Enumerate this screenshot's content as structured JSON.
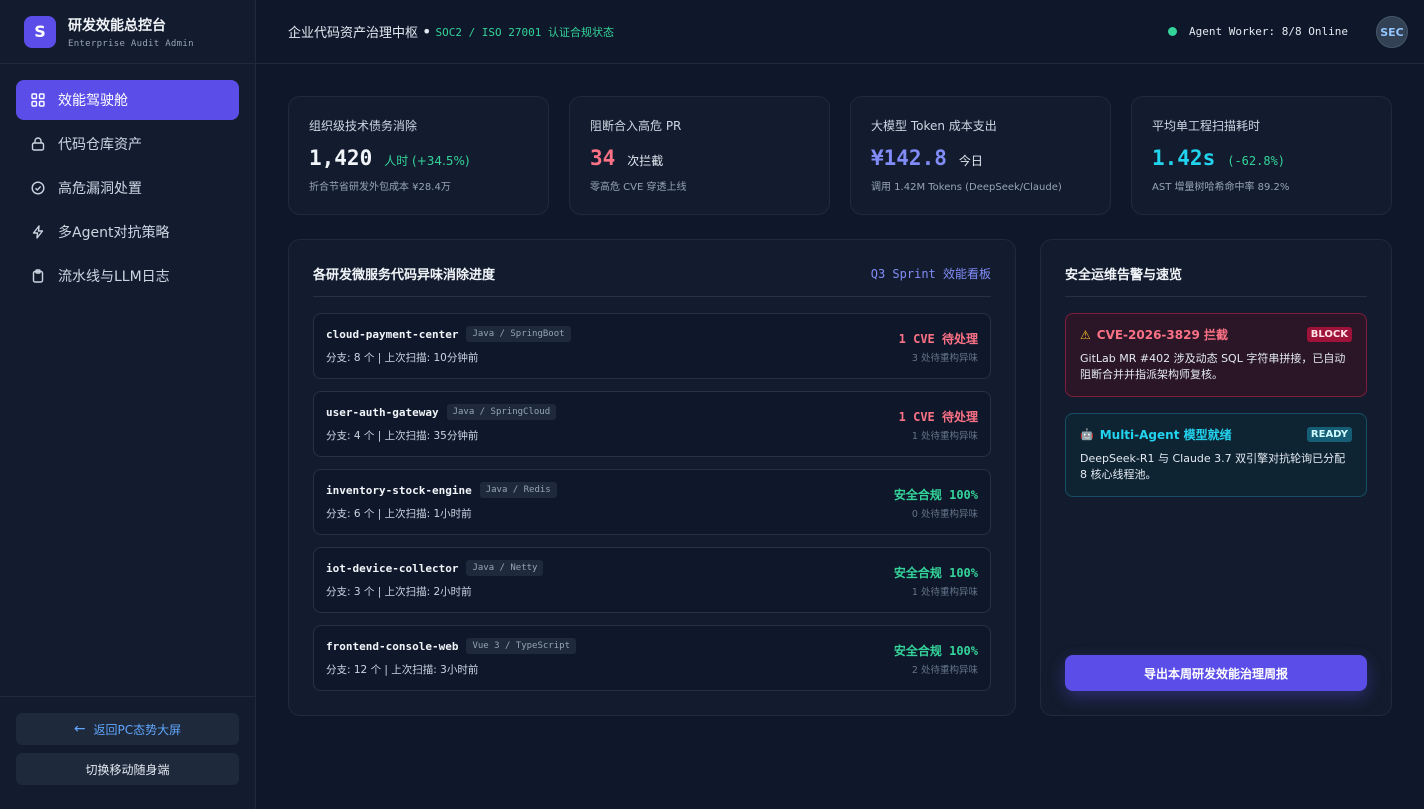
{
  "brand": {
    "logo": "S",
    "title": "研发效能总控台",
    "subtitle": "Enterprise Audit Admin"
  },
  "nav": [
    {
      "label": "效能驾驶舱",
      "icon": "grid-icon",
      "active": true
    },
    {
      "label": "代码仓库资产",
      "icon": "lock-icon",
      "active": false
    },
    {
      "label": "高危漏洞处置",
      "icon": "check-circle-icon",
      "active": false
    },
    {
      "label": "多Agent对抗策略",
      "icon": "bolt-icon",
      "active": false
    },
    {
      "label": "流水线与LLM日志",
      "icon": "clipboard-icon",
      "active": false
    }
  ],
  "sidebar_buttons": {
    "back_arrow": "←",
    "back": "返回PC态势大屏",
    "mobile": "切换移动随身端"
  },
  "header": {
    "title": "企业代码资产治理中枢",
    "dot": "•",
    "subtitle": "SOC2 / ISO 27001 认证合规状态",
    "agent_status": "Agent Worker: 8/8 Online",
    "avatar": "SEC"
  },
  "kpis": [
    {
      "label": "组织级技术债务消除",
      "value": "1,420",
      "unit": "人时 (+34.5%)",
      "note": "折合节省研发外包成本 ¥28.4万",
      "value_color": "#f1f5f9",
      "unit_color": "#34d399"
    },
    {
      "label": "阻断合入高危 PR",
      "value": "34",
      "unit": "次拦截",
      "note": "零高危 CVE 穿透上线",
      "value_color": "#fb7185",
      "unit_color": "#e2e8f0"
    },
    {
      "label": "大模型 Token 成本支出",
      "value": "¥142.8",
      "unit": "今日",
      "note": "调用 1.42M Tokens (DeepSeek/Claude)",
      "value_color": "#818cf8",
      "unit_color": "#e2e8f0"
    },
    {
      "label": "平均单工程扫描耗时",
      "value": "1.42s",
      "unit": "(-62.8%)",
      "note": "AST 增量树哈希命中率 89.2%",
      "value_color": "#22d3ee",
      "unit_color": "#34d399"
    }
  ],
  "progress_panel": {
    "title": "各研发微服务代码异味消除进度",
    "link": "Q3 Sprint 效能看板",
    "services": [
      {
        "name": "cloud-payment-center",
        "tag": "Java / SpringBoot",
        "meta": "分支: 8 个 | 上次扫描: 10分钟前",
        "status": "1 CVE 待处理",
        "status_type": "bad",
        "sub": "3 处待重构异味"
      },
      {
        "name": "user-auth-gateway",
        "tag": "Java / SpringCloud",
        "meta": "分支: 4 个 | 上次扫描: 35分钟前",
        "status": "1 CVE 待处理",
        "status_type": "bad",
        "sub": "1 处待重构异味"
      },
      {
        "name": "inventory-stock-engine",
        "tag": "Java / Redis",
        "meta": "分支: 6 个 | 上次扫描: 1小时前",
        "status": "安全合规 100%",
        "status_type": "ok",
        "sub": "0 处待重构异味"
      },
      {
        "name": "iot-device-collector",
        "tag": "Java / Netty",
        "meta": "分支: 3 个 | 上次扫描: 2小时前",
        "status": "安全合规 100%",
        "status_type": "ok",
        "sub": "1 处待重构异味"
      },
      {
        "name": "frontend-console-web",
        "tag": "Vue 3 / TypeScript",
        "meta": "分支: 12 个 | 上次扫描: 3小时前",
        "status": "安全合规 100%",
        "status_type": "ok",
        "sub": "2 处待重构异味"
      }
    ]
  },
  "alerts_panel": {
    "title": "安全运维告警与速览",
    "alerts": [
      {
        "icon": "⚠",
        "title": "CVE-2026-3829 拦截",
        "badge": "BLOCK",
        "body": "GitLab MR #402 涉及动态 SQL 字符串拼接，已自动阻断合并并指派架构师复核。"
      },
      {
        "icon": "🤖",
        "title": "Multi-Agent 模型就绪",
        "badge": "READY",
        "body": "DeepSeek-R1 与 Claude 3.7 双引擎对抗轮询已分配 8 核心线程池。"
      }
    ],
    "export_label": "导出本周研发效能治理周报"
  }
}
